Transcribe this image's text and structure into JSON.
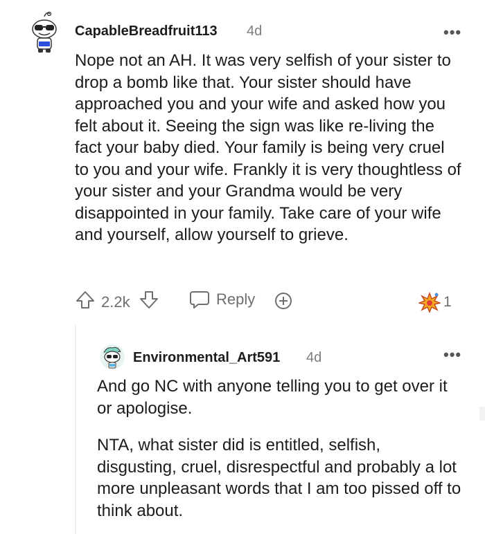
{
  "comment": {
    "username": "CapableBreadfruit113",
    "age": "4d",
    "paragraphs": [
      "Nope not an AH. It was very selfish of your sister to drop a bomb like that. Your sister should have approached you and your wife and asked how you felt about it. Seeing the sign was like re-living the fact your baby died. Your family is being very cruel to you and your wife. Frankly it is very thoughtless of your sister and your Grandma would be very disappointed in your family. Take care of your wife and yourself, allow yourself to grieve."
    ],
    "votes": "2.2k",
    "reply_label": "Reply",
    "awards_count": "1",
    "more_label": "•••"
  },
  "reply": {
    "username": "Environmental_Art591",
    "age": "4d",
    "paragraphs": [
      "And go NC with anyone telling you to get over it or apologise.",
      "NTA, what sister did is entitled, selfish, disgusting, cruel, disrespectful and probably a lot more unpleasant words that I am too pissed off to think about."
    ],
    "more_label": "•••"
  },
  "icons": {
    "upvote": "arrow-up-icon",
    "downvote": "arrow-down-icon",
    "reply": "speech-bubble-icon",
    "award": "plus-circle-icon",
    "award_received": "starburst-award-icon"
  }
}
